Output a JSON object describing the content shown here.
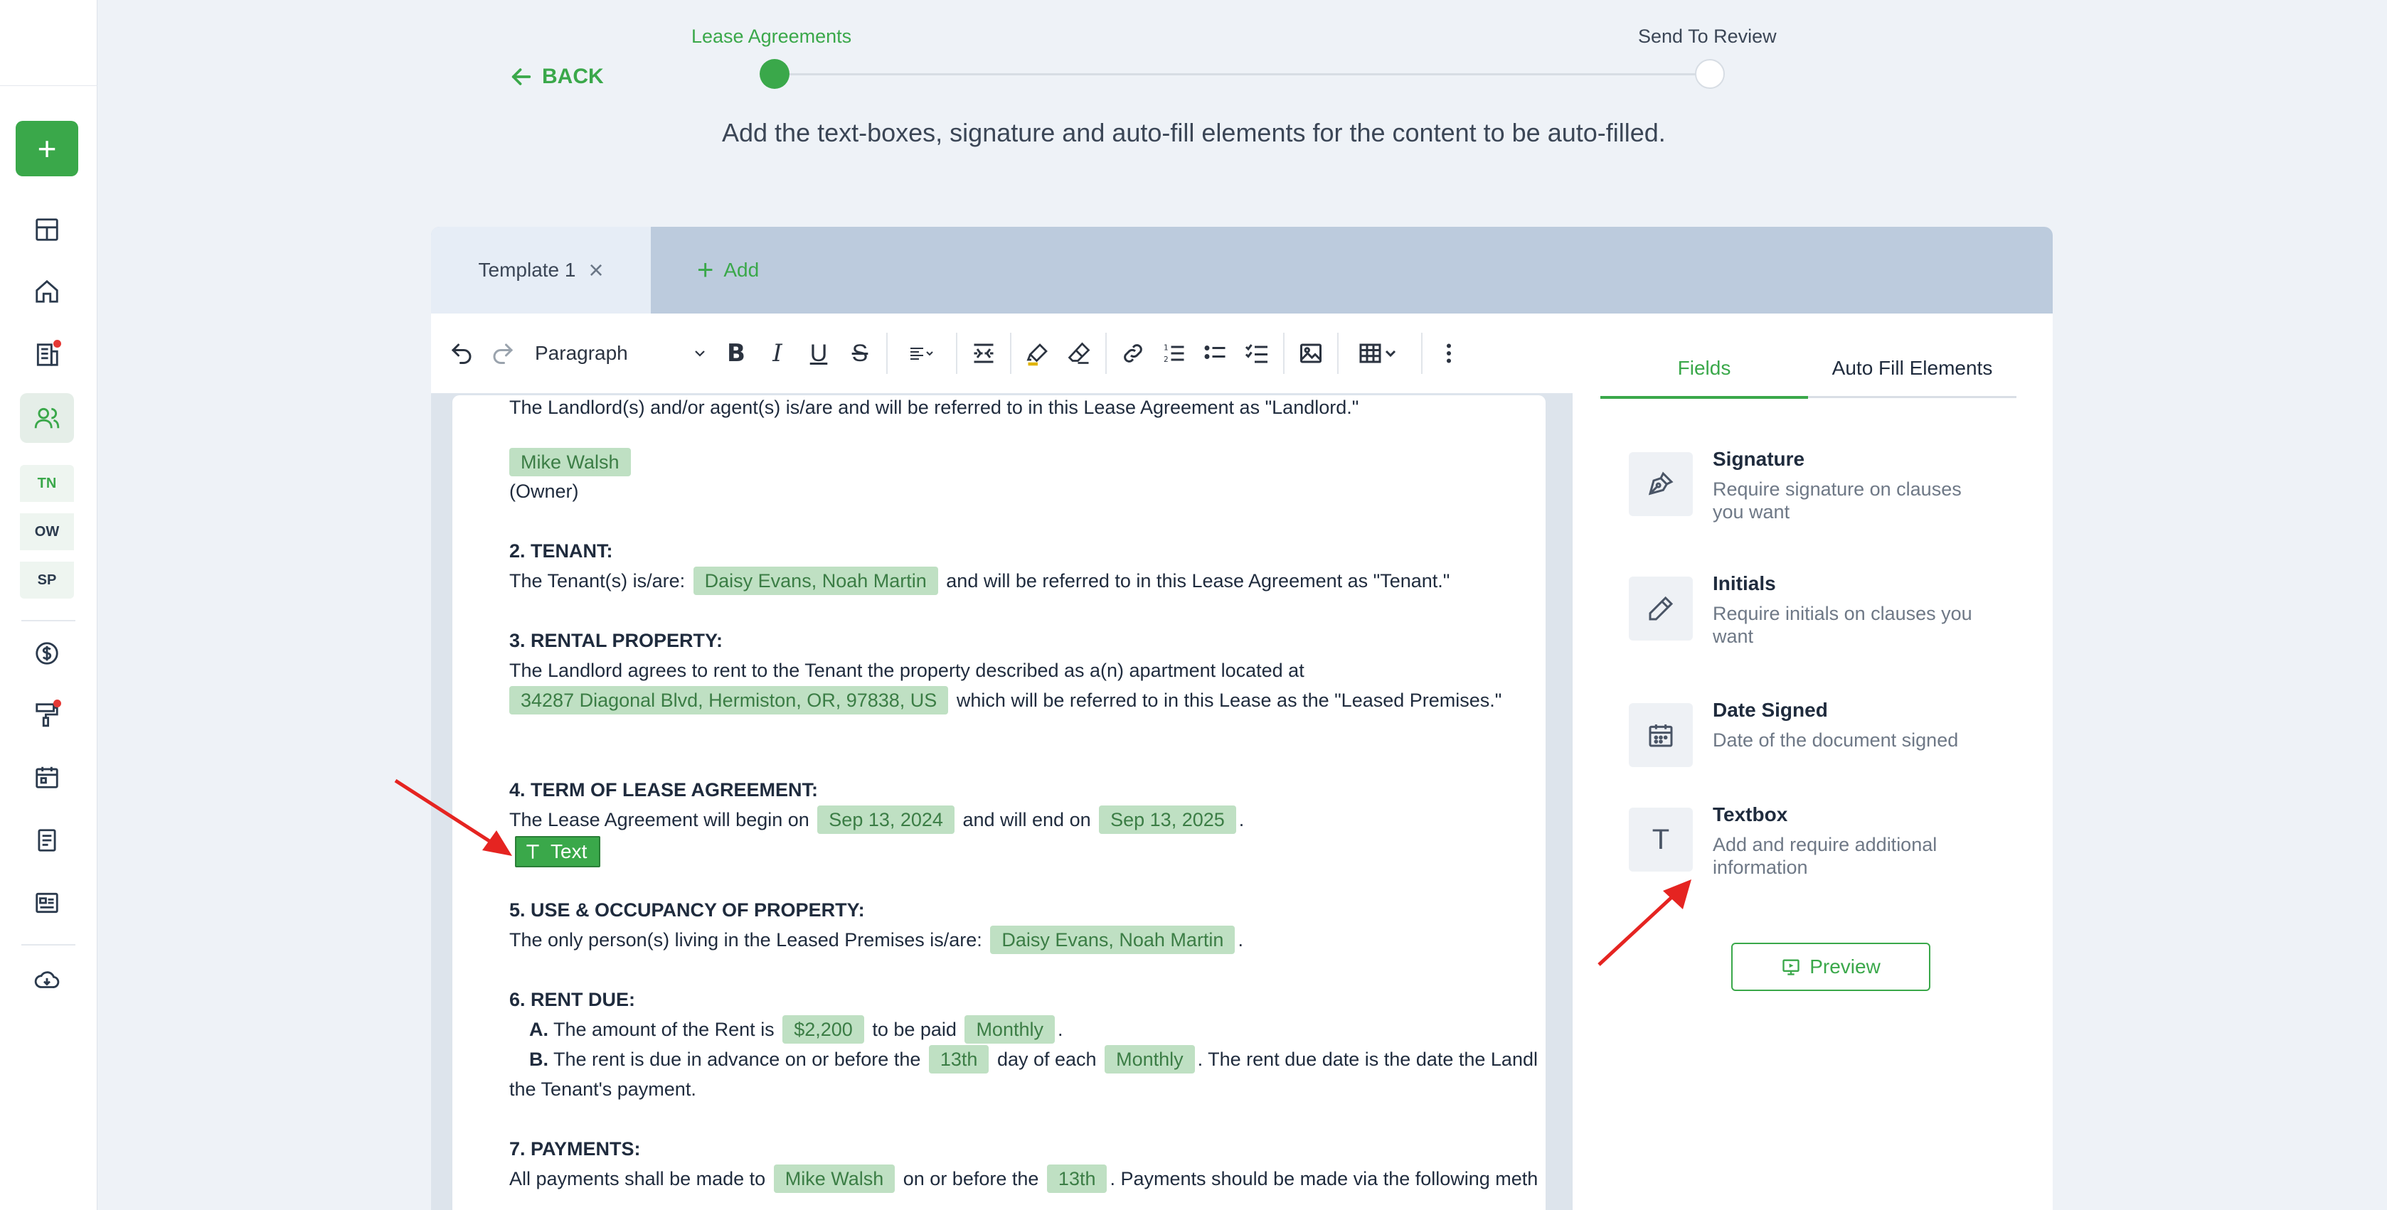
{
  "stepper": {
    "back_label": "BACK",
    "step1": "Lease Agreements",
    "step2": "Send To Review"
  },
  "subtitle": "Add the text-boxes, signature and auto-fill elements for the content to be auto-filled.",
  "sidebar": {
    "items": [
      "TN",
      "OW",
      "SP"
    ]
  },
  "tabs": {
    "active": "Template 1",
    "add": "Add"
  },
  "toolbar": {
    "paragraph": "Paragraph"
  },
  "document": {
    "landlord_line": "The Landlord(s) and/or agent(s) is/are and will be referred to in this Lease Agreement as \"Landlord.\"",
    "owner_name": "Mike Walsh",
    "owner_label": "(Owner)",
    "tenant_heading": "2. TENANT:",
    "tenant_pre": "The Tenant(s) is/are:",
    "tenant_names": "Daisy Evans, Noah Martin",
    "tenant_post": "and will be referred to in this Lease Agreement as \"Tenant.\"",
    "property_heading": "3. RENTAL PROPERTY:",
    "property_line": "The Landlord agrees to rent to the Tenant the property described as a(n) apartment located at",
    "property_address": "34287 Diagonal Blvd, Hermiston, OR, 97838, US",
    "property_post": "which will be referred to in this Lease as the \"Leased Premises.\"",
    "term_heading": "4. TERM OF LEASE AGREEMENT:",
    "term_pre": "The Lease Agreement will begin on",
    "term_start": "Sep 13, 2024",
    "term_mid": "and will end on",
    "term_end": "Sep 13, 2025",
    "term_dot": ".",
    "text_widget": "Text",
    "use_heading": "5. USE & OCCUPANCY OF PROPERTY:",
    "use_pre": "The only person(s) living in the Leased Premises is/are:",
    "use_names": "Daisy Evans, Noah Martin",
    "use_dot": ".",
    "rent_heading": "6. RENT DUE:",
    "rent_a_label": "A.",
    "rent_a_pre": "The amount of the Rent is",
    "rent_amount": "$2,200",
    "rent_a_mid": "to be paid",
    "rent_freq": "Monthly",
    "rent_a_dot": ".",
    "rent_b_label": "B.",
    "rent_b_pre": "The rent is due in advance on or before the",
    "rent_day": "13th",
    "rent_b_mid": "day of each",
    "rent_b_freq": "Monthly",
    "rent_b_post": ". The rent due date is the date the Landl",
    "rent_b_cont": "the Tenant's payment.",
    "pay_heading": "7. PAYMENTS:",
    "pay_pre": "All payments shall be made to",
    "pay_name": "Mike Walsh",
    "pay_mid": "on or before the",
    "pay_day": "13th",
    "pay_post": ". Payments should be made via the following meth"
  },
  "panel": {
    "tab_fields": "Fields",
    "tab_auto": "Auto Fill Elements",
    "fields": [
      {
        "title": "Signature",
        "desc": "Require signature on clauses you want",
        "icon": "pen-nib-icon"
      },
      {
        "title": "Initials",
        "desc": "Require initials on clauses you want",
        "icon": "pencil-icon"
      },
      {
        "title": "Date Signed",
        "desc": "Date of the document signed",
        "icon": "calendar-icon"
      },
      {
        "title": "Textbox",
        "desc": "Add and require additional information",
        "icon": "text-t-icon"
      }
    ],
    "preview": "Preview"
  },
  "colors": {
    "accent": "#3aa84a",
    "chip_bg": "#bfe0c3",
    "arrow": "#e52421"
  }
}
